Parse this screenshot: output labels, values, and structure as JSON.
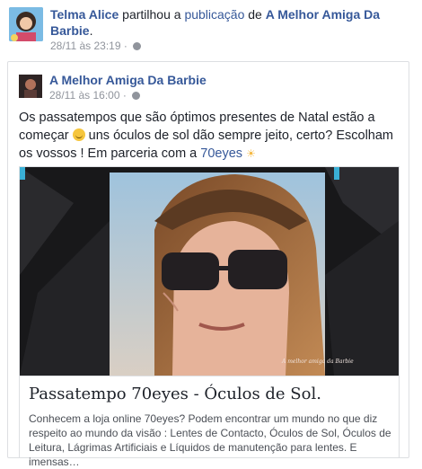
{
  "share": {
    "user_name": "Telma Alice",
    "verb": "partilhou a",
    "publication_word": "publicação",
    "preposition": "de",
    "page_name": "A Melhor Amiga Da Barbie",
    "suffix": ".",
    "timestamp": "28/11 às 23:19",
    "separator": "·"
  },
  "post": {
    "page_name": "A Melhor Amiga Da Barbie",
    "timestamp": "28/11 às 16:00",
    "separator": "·",
    "text_part1": "Os passatempos que são óptimos presentes de Natal estão a começar",
    "text_part2": "uns óculos de sol dão sempre jeito, certo? Escolham os vossos ! Em parceria com a",
    "link_text": "70eyes",
    "image_watermark": "A melhor amiga da Barbie"
  },
  "link_preview": {
    "title": "Passatempo 70eyes - Óculos de Sol.",
    "description": "Conhecem a loja online 70eyes? Podem encontrar um mundo no que diz respeito ao mundo da visão : Lentes de Contacto, Óculos de Sol, Óculos de Leitura, Lágrimas Artificiais e Líquidos de manutenção para lentes. E imensas…"
  },
  "colors": {
    "link": "#365899",
    "meta": "#90949c",
    "text": "#1d2129"
  }
}
